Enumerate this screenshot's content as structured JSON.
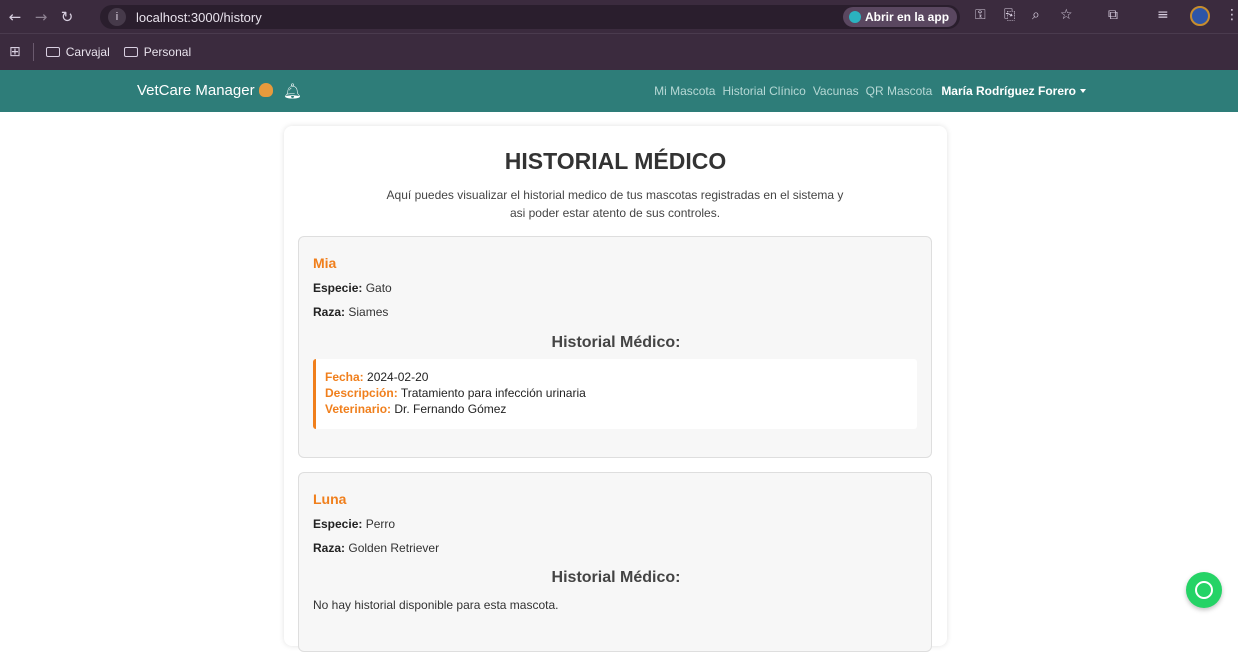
{
  "browser": {
    "url": "localhost:3000/history",
    "open_app_label": "Abrir en la app",
    "bookmarks": [
      "Carvajal",
      "Personal"
    ]
  },
  "app": {
    "brand": "VetCare Manager",
    "nav_links": [
      "Mi Mascota",
      "Historial Clínico",
      "Vacunas",
      "QR Mascota"
    ],
    "user_name": "María Rodríguez Forero"
  },
  "page": {
    "title": "HISTORIAL MÉDICO",
    "intro": "Aquí puedes visualizar el historial medico de tus mascotas registradas en el sistema y asi poder estar atento de sus controles."
  },
  "pets": [
    {
      "name": "Mia",
      "species_label": "Especie:",
      "species": "Gato",
      "breed_label": "Raza:",
      "breed": "Siames",
      "history_title": "Historial Médico:",
      "record": {
        "date_label": "Fecha:",
        "date": "2024-02-20",
        "desc_label": "Descripción:",
        "desc": "Tratamiento para infección urinaria",
        "vet_label": "Veterinario:",
        "vet": "Dr. Fernando Gómez"
      }
    },
    {
      "name": "Luna",
      "species_label": "Especie:",
      "species": "Perro",
      "breed_label": "Raza:",
      "breed": "Golden Retriever",
      "history_title": "Historial Médico:",
      "empty_text": "No hay historial disponible para esta mascota."
    }
  ],
  "icons": {
    "back": "back-arrow-icon",
    "forward": "forward-arrow-icon",
    "reload": "reload-icon",
    "bell": "bell-icon",
    "whatsapp": "whatsapp-icon"
  },
  "colors": {
    "navbar": "#2e7d79",
    "accent": "#f07f1c",
    "chrome": "#3b2b3e"
  }
}
